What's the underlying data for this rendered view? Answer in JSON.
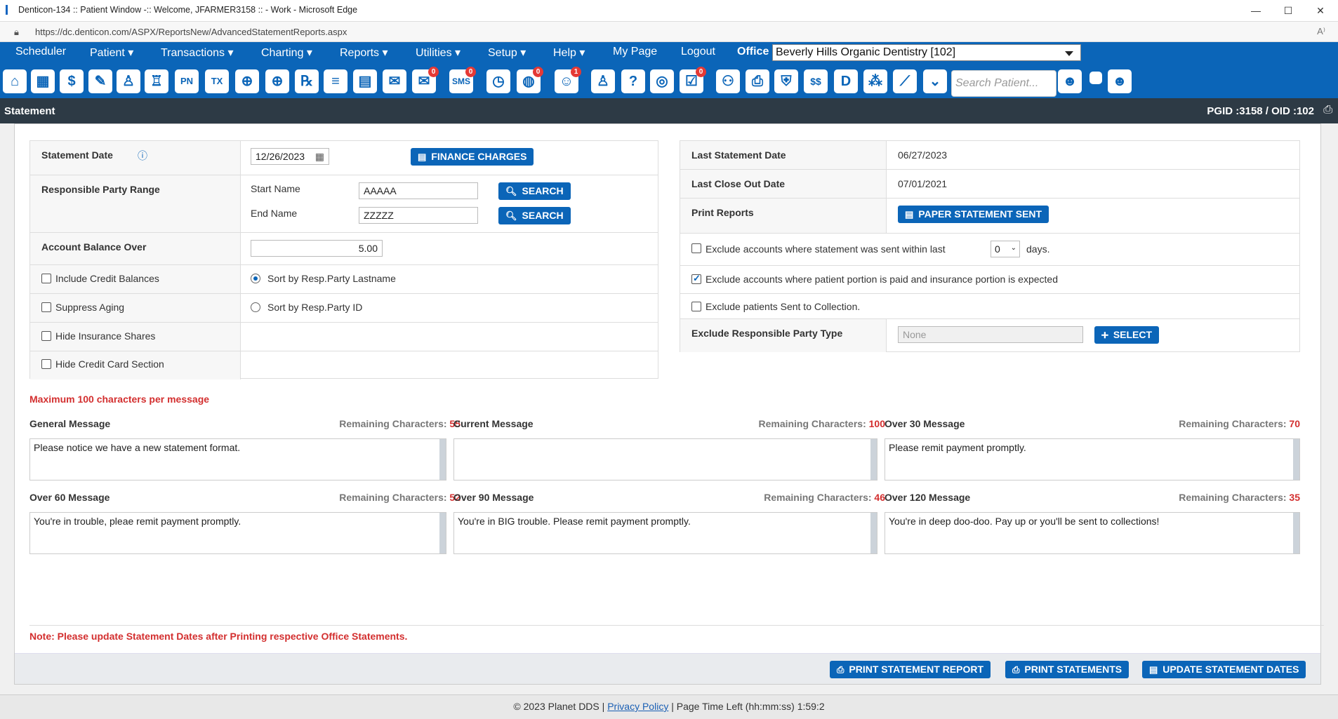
{
  "window": {
    "title": "Denticon-134 :: Patient Window -:: Welcome, JFARMER3158 :: - Work - Microsoft Edge",
    "url": "https://dc.denticon.com/ASPX/ReportsNew/AdvancedStatementReports.aspx",
    "minimize": "—",
    "maximize": "☐",
    "close": "✕"
  },
  "menu": {
    "items": [
      "Scheduler",
      "Patient ▾",
      "Transactions ▾",
      "Charting ▾",
      "Reports ▾",
      "Utilities ▾",
      "Setup ▾",
      "Help ▾",
      "My Page",
      "Logout"
    ],
    "office_label": "Office",
    "office_value": "Beverly Hills Organic Dentistry [102]"
  },
  "toolbar": {
    "search_placeholder": "Search Patient...",
    "badge_values": [
      "0",
      "0",
      "0",
      "1",
      "0"
    ]
  },
  "page_header": {
    "title": "Statement",
    "ids": "PGID :3158  /  OID :102"
  },
  "left": {
    "statement_date_label": "Statement Date",
    "statement_date": "12/26/2023",
    "finance_btn": "FINANCE CHARGES",
    "resp_party_label": "Responsible Party Range",
    "start_name_label": "Start Name",
    "start_name": "AAAAA",
    "end_name_label": "End Name",
    "end_name": "ZZZZZ",
    "search_btn": "SEARCH",
    "acct_balance_label": "Account Balance Over",
    "acct_balance": "5.00",
    "include_credit": "Include Credit Balances",
    "suppress_aging": "Suppress Aging",
    "hide_insurance": "Hide Insurance Shares",
    "hide_credit_card": "Hide Credit Card Section",
    "sort_lastname": "Sort by Resp.Party Lastname",
    "sort_id": "Sort by Resp.Party ID"
  },
  "right": {
    "last_statement_label": "Last Statement Date",
    "last_statement": "06/27/2023",
    "last_close_label": "Last Close Out Date",
    "last_close": "07/01/2021",
    "print_reports_label": "Print Reports",
    "paper_btn": "PAPER STATEMENT SENT",
    "exclude_sent_pre": "Exclude accounts where statement was sent within last",
    "exclude_sent_days": "0",
    "exclude_sent_post": "days.",
    "exclude_patient_portion": "Exclude accounts where patient portion is paid and insurance portion is expected",
    "exclude_collection": "Exclude patients Sent to Collection.",
    "exclude_type_label": "Exclude Responsible Party Type",
    "exclude_type_value": "None",
    "select_btn": "SELECT"
  },
  "messages": {
    "max_note": "Maximum 100 characters per message",
    "remaining_label": "Remaining Characters:",
    "items": [
      {
        "title": "General Message",
        "remaining": "55",
        "text": "Please notice we have a new statement format."
      },
      {
        "title": "Current Message",
        "remaining": "100",
        "text": ""
      },
      {
        "title": "Over 30 Message",
        "remaining": "70",
        "text": "Please remit payment promptly."
      },
      {
        "title": "Over 60 Message",
        "remaining": "52",
        "text": "You're in trouble, pleae remit payment promptly."
      },
      {
        "title": "Over 90 Message",
        "remaining": "46",
        "text": "You're in BIG trouble.  Please remit payment promptly."
      },
      {
        "title": "Over 120 Message",
        "remaining": "35",
        "text": "You're in deep doo-doo.  Pay up or you'll be sent to collections!"
      }
    ]
  },
  "note": "Note: Please update Statement Dates after Printing respective Office Statements.",
  "actions": {
    "print_report": "PRINT STATEMENT REPORT",
    "print_statements": "PRINT STATEMENTS",
    "update_dates": "UPDATE STATEMENT DATES"
  },
  "footer": {
    "copyright": "© 2023 Planet DDS | ",
    "privacy": "Privacy Policy",
    "time_left": " |  Page Time Left (hh:mm:ss) 1:59:2"
  },
  "colors": {
    "brand": "#0b65b8",
    "header_dark": "#2d3a45",
    "warn_red": "#d32f2f"
  }
}
